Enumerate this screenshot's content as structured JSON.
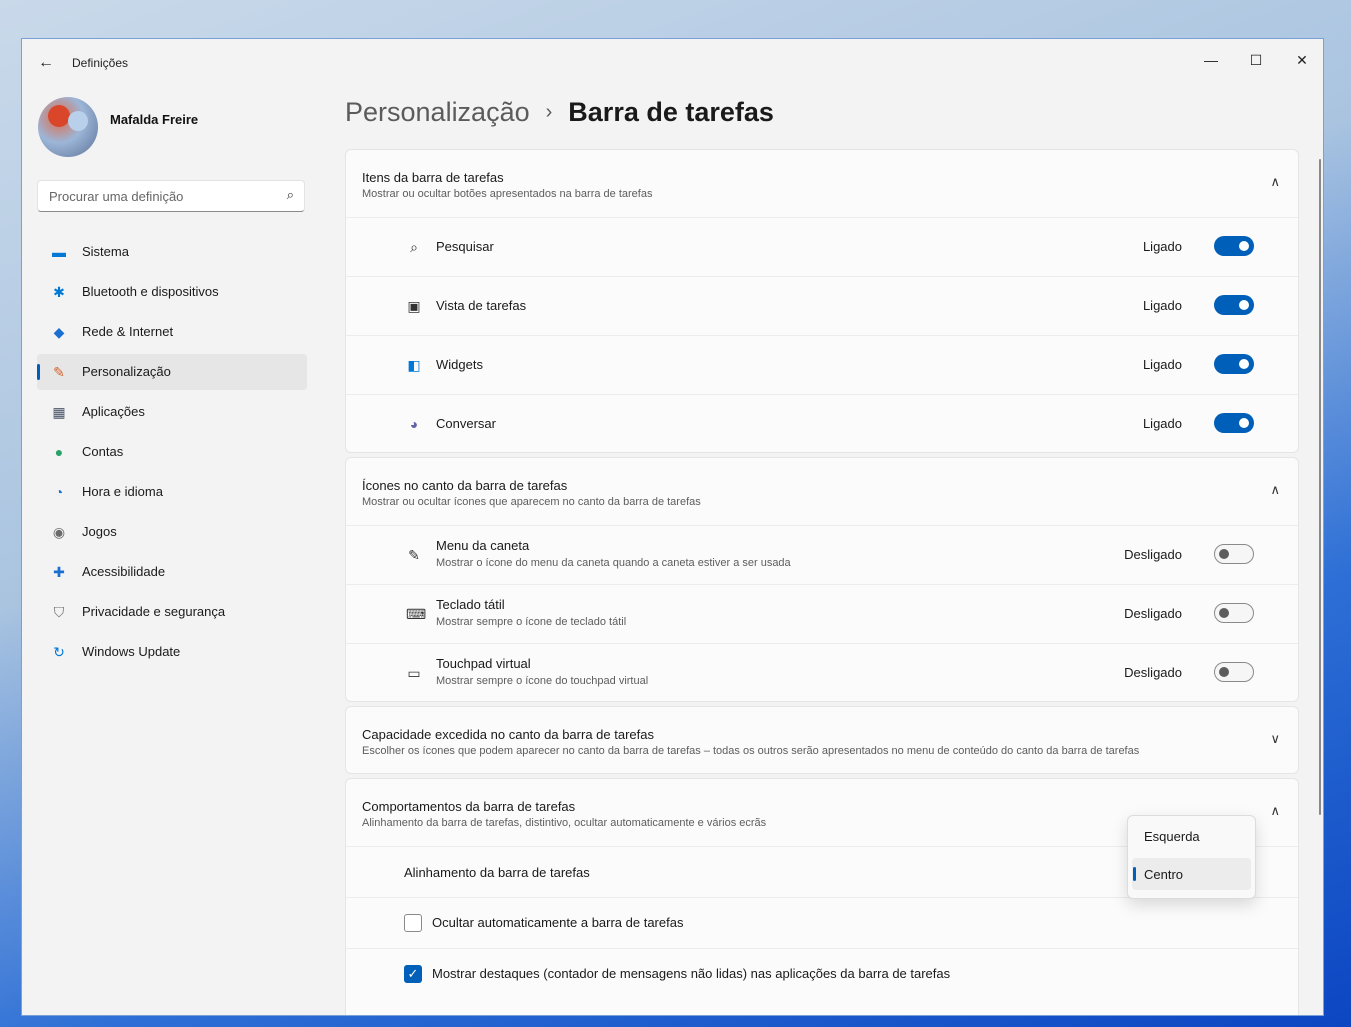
{
  "window": {
    "title": "Definições",
    "back_icon": "←",
    "minimize_icon": "—",
    "maximize_icon": "☐",
    "close_icon": "✕"
  },
  "user": {
    "name": "Mafalda Freire"
  },
  "search": {
    "placeholder": "Procurar uma definição",
    "icon": "⌕"
  },
  "nav": [
    {
      "label": "Sistema",
      "icon": "▬",
      "color": "#0078d4"
    },
    {
      "label": "Bluetooth e dispositivos",
      "icon": "✱",
      "color": "#0078d4"
    },
    {
      "label": "Rede & Internet",
      "icon": "◆",
      "color": "#1b6fd1"
    },
    {
      "label": "Personalização",
      "icon": "✎",
      "color": "#d3632a"
    },
    {
      "label": "Aplicações",
      "icon": "▦",
      "color": "#4a5468"
    },
    {
      "label": "Contas",
      "icon": "●",
      "color": "#2aa06a"
    },
    {
      "label": "Hora e idioma",
      "icon": "◔",
      "color": "#1b6fd1"
    },
    {
      "label": "Jogos",
      "icon": "◉",
      "color": "#6b6b6b"
    },
    {
      "label": "Acessibilidade",
      "icon": "✚",
      "color": "#1b6fd1"
    },
    {
      "label": "Privacidade e segurança",
      "icon": "⛉",
      "color": "#6b6b6b"
    },
    {
      "label": "Windows Update",
      "icon": "↻",
      "color": "#0078d4"
    }
  ],
  "breadcrumb": {
    "parent": "Personalização",
    "separator": "›",
    "current": "Barra de tarefas"
  },
  "sections": {
    "items": {
      "title": "Itens da barra de tarefas",
      "subtitle": "Mostrar ou ocultar botões apresentados na barra de tarefas",
      "chevron": "∧",
      "rows": [
        {
          "label": "Pesquisar",
          "state": "Ligado",
          "icon": "⌕"
        },
        {
          "label": "Vista de tarefas",
          "state": "Ligado",
          "icon": "▣"
        },
        {
          "label": "Widgets",
          "state": "Ligado",
          "icon": "◧"
        },
        {
          "label": "Conversar",
          "state": "Ligado",
          "icon": "◕"
        }
      ]
    },
    "corner": {
      "title": "Ícones no canto da barra de tarefas",
      "subtitle": "Mostrar ou ocultar ícones que aparecem no canto da barra de tarefas",
      "chevron": "∧",
      "rows": [
        {
          "label": "Menu da caneta",
          "desc": "Mostrar o ícone do menu da caneta quando a caneta estiver a ser usada",
          "state": "Desligado",
          "icon": "✎"
        },
        {
          "label": "Teclado tátil",
          "desc": "Mostrar sempre o ícone de teclado tátil",
          "state": "Desligado",
          "icon": "⌨"
        },
        {
          "label": "Touchpad virtual",
          "desc": "Mostrar sempre o ícone do touchpad virtual",
          "state": "Desligado",
          "icon": "▭"
        }
      ]
    },
    "overflow": {
      "title": "Capacidade excedida no canto da barra de tarefas",
      "subtitle": "Escolher os ícones que podem aparecer no canto da barra de tarefas – todas os outros serão apresentados no menu de conteúdo do canto da barra de tarefas",
      "chevron": "∨"
    },
    "behaviors": {
      "title": "Comportamentos da barra de tarefas",
      "subtitle": "Alinhamento da barra de tarefas, distintivo, ocultar automaticamente e vários ecrãs",
      "chevron": "∧",
      "alignment_label": "Alinhamento da barra de tarefas",
      "autohide_label": "Ocultar automaticamente a barra de tarefas",
      "badges_label": "Mostrar destaques (contador de mensagens não lidas) nas aplicações da barra de tarefas",
      "check_icon": "✓"
    }
  },
  "dropdown": {
    "options": [
      "Esquerda",
      "Centro"
    ],
    "selected": "Centro"
  }
}
